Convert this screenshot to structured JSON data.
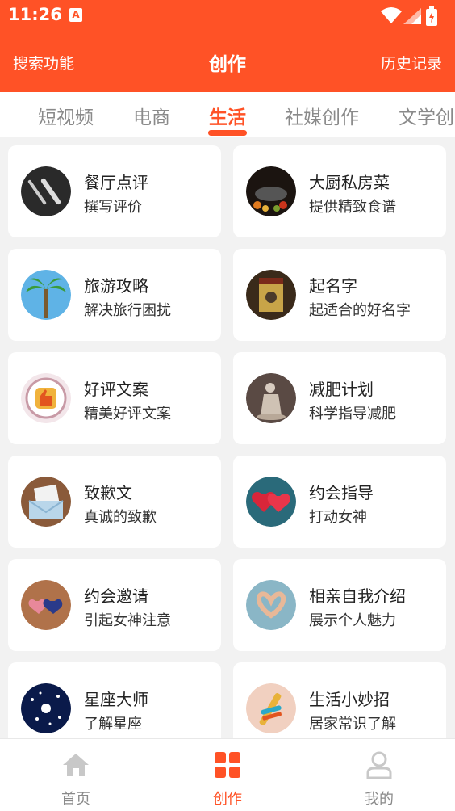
{
  "status_bar": {
    "time": "11:26",
    "notification_badge": "A"
  },
  "header": {
    "left_label": "搜索功能",
    "title": "创作",
    "right_label": "历史记录"
  },
  "tabs": [
    {
      "label": "短视频"
    },
    {
      "label": "电商"
    },
    {
      "label": "生活",
      "active": true
    },
    {
      "label": "社媒创作"
    },
    {
      "label": "文学创"
    }
  ],
  "cards": [
    {
      "title": "餐厅点评",
      "subtitle": "撰写评价",
      "icon": "fork-knife-icon"
    },
    {
      "title": "大厨私房菜",
      "subtitle": "提供精致食谱",
      "icon": "wok-icon"
    },
    {
      "title": "旅游攻略",
      "subtitle": "解决旅行困扰",
      "icon": "palm-tree-icon"
    },
    {
      "title": "起名字",
      "subtitle": "起适合的好名字",
      "icon": "name-plaque-icon"
    },
    {
      "title": "好评文案",
      "subtitle": "精美好评文案",
      "icon": "thumbs-up-icon"
    },
    {
      "title": "减肥计划",
      "subtitle": "科学指导减肥",
      "icon": "statue-icon"
    },
    {
      "title": "致歉文",
      "subtitle": "真诚的致歉",
      "icon": "envelope-letter-icon"
    },
    {
      "title": "约会指导",
      "subtitle": "打动女神",
      "icon": "hearts-icon"
    },
    {
      "title": "约会邀请",
      "subtitle": "引起女神注意",
      "icon": "two-hearts-icon"
    },
    {
      "title": "相亲自我介绍",
      "subtitle": "展示个人魅力",
      "icon": "hand-heart-icon"
    },
    {
      "title": "星座大师",
      "subtitle": "了解星座",
      "icon": "starry-sky-icon"
    },
    {
      "title": "生活小妙招",
      "subtitle": "居家常识了解",
      "icon": "toothbrush-icon"
    }
  ],
  "bottom_nav": [
    {
      "label": "首页",
      "icon": "home-icon"
    },
    {
      "label": "创作",
      "icon": "grid-icon",
      "active": true
    },
    {
      "label": "我的",
      "icon": "user-icon"
    }
  ],
  "colors": {
    "accent": "#ff5226",
    "background": "#f2f2f2"
  }
}
